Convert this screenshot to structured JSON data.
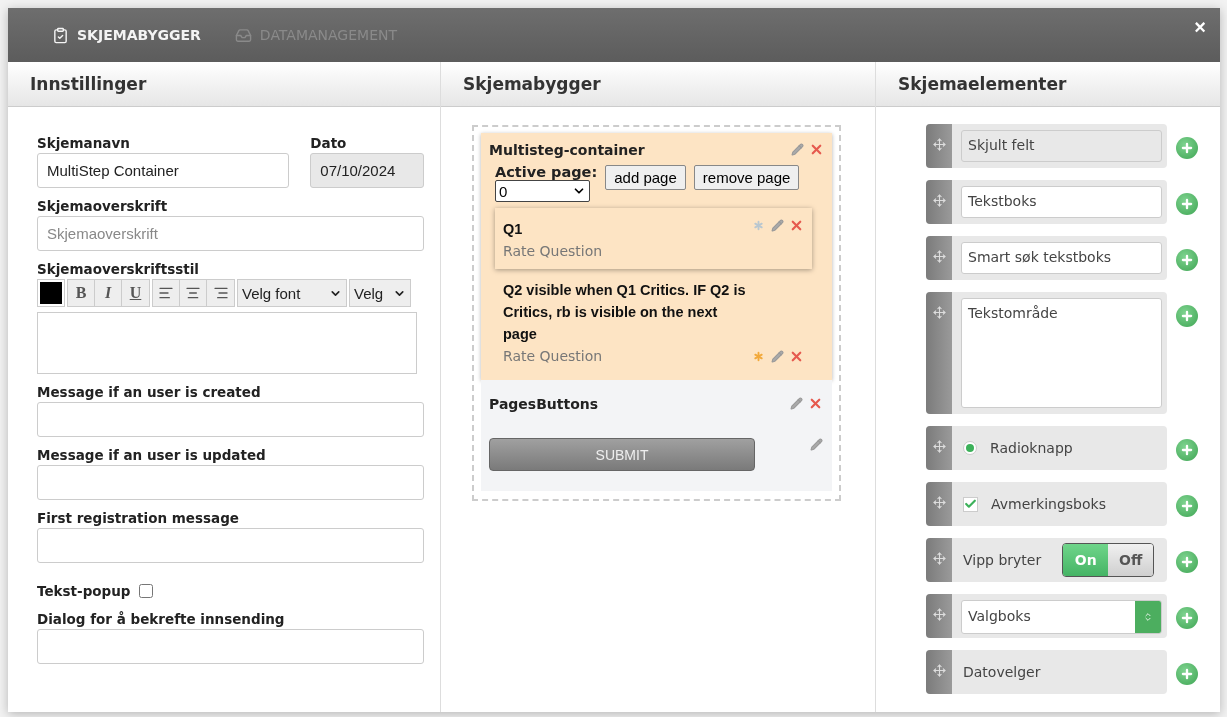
{
  "tabs": [
    {
      "label": "SKJEMABYGGER",
      "selected": true
    },
    {
      "label": "DATAMANAGEMENT",
      "selected": false
    }
  ],
  "close": "×",
  "settings": {
    "title": "Innstillinger",
    "name_field": {
      "label": "Skjemanavn",
      "value": "MultiStep Container"
    },
    "date_field": {
      "label": "Dato",
      "value": "07/10/2024",
      "disabled": true
    },
    "fields": [
      {
        "kind": "input",
        "label": "Skjemaoverskrift",
        "placeholder": "Skjemaoverskrift"
      },
      {
        "kind": "editor",
        "label": "Skjemaoverskriftsstil",
        "bold": "B",
        "italic": "I",
        "underline": "U",
        "font_select": "Velg font",
        "size_select": "Velg"
      },
      {
        "kind": "input",
        "label": "Message if an user is created"
      },
      {
        "kind": "input",
        "label": "Message if an user is updated"
      },
      {
        "kind": "input",
        "label": "First registration message"
      },
      {
        "kind": "checkbox",
        "label": "Tekst-popup",
        "checked": false
      },
      {
        "kind": "input",
        "label": "Dialog for å bekrefte innsending"
      }
    ]
  },
  "builder": {
    "title": "Skjemabygger",
    "container": {
      "title": "Multisteg-container",
      "active_page_label": "Active page:",
      "active_page": "0",
      "add_button": "add page",
      "remove_button": "remove page",
      "questions": [
        {
          "title": "Q1",
          "type": "Rate Question",
          "starred": false,
          "selected": true
        },
        {
          "title": "Q2 visible when Q1 Critics. IF Q2 is Critics, rb is visible on the next page",
          "type": "Rate Question",
          "starred": true,
          "selected": false
        }
      ]
    },
    "pages_buttons": {
      "title": "PagesButtons",
      "submit": "SUBMIT"
    }
  },
  "elements": {
    "title": "Skjemaelementer",
    "items": [
      {
        "kind": "hidden",
        "label": "Skjult felt"
      },
      {
        "kind": "textbox",
        "label": "Tekstboks"
      },
      {
        "kind": "textbox",
        "label": "Smart søk tekstboks"
      },
      {
        "kind": "textarea",
        "label": "Tekstområde"
      },
      {
        "kind": "radio",
        "label": "Radioknapp",
        "checked": true
      },
      {
        "kind": "checkbox",
        "label": "Avmerkingsboks",
        "checked": true
      },
      {
        "kind": "toggle",
        "label": "Vipp bryter",
        "on": true,
        "on_label": "On",
        "off_label": "Off"
      },
      {
        "kind": "select",
        "label": "Valgboks"
      },
      {
        "kind": "plain",
        "label": "Datovelger"
      }
    ]
  }
}
